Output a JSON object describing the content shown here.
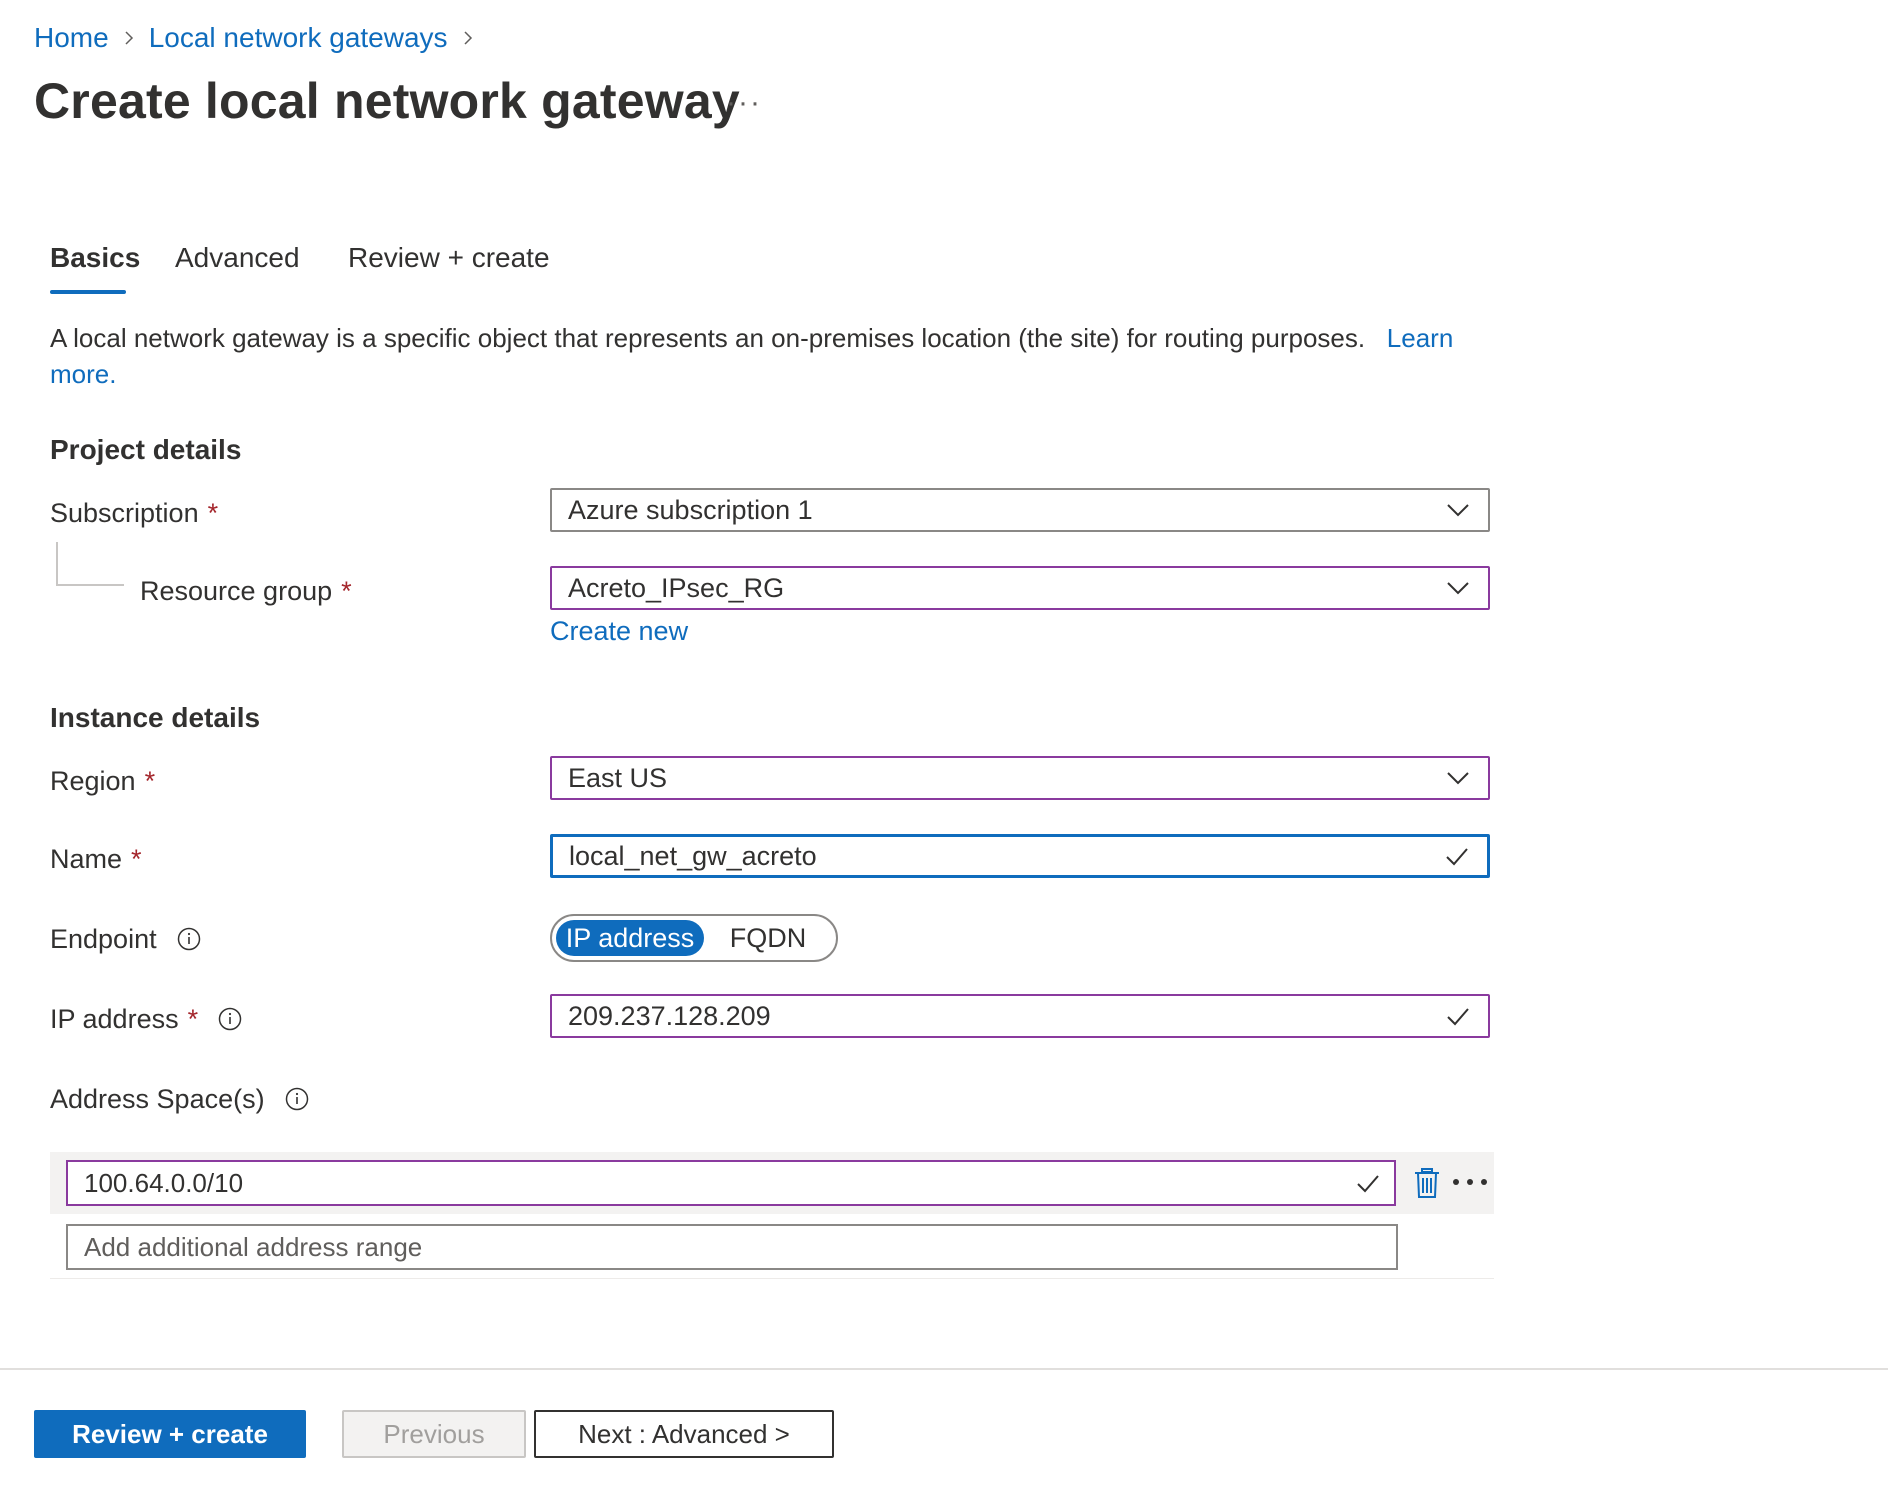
{
  "breadcrumb": {
    "home": "Home",
    "parent": "Local network gateways"
  },
  "page": {
    "title": "Create local network gateway",
    "more": "···"
  },
  "tabs": [
    {
      "label": "Basics",
      "active": true
    },
    {
      "label": "Advanced",
      "active": false
    },
    {
      "label": "Review + create",
      "active": false
    }
  ],
  "description": {
    "text": "A local network gateway is a specific object that represents an on-premises location (the site) for routing purposes.",
    "link": "Learn more."
  },
  "project_details": {
    "title": "Project details",
    "subscription": {
      "label": "Subscription",
      "required": "*",
      "value": "Azure subscription 1"
    },
    "resource_group": {
      "label": "Resource group",
      "required": "*",
      "value": "Acreto_IPsec_RG",
      "create_new": "Create new"
    }
  },
  "instance_details": {
    "title": "Instance details",
    "region": {
      "label": "Region",
      "required": "*",
      "value": "East US"
    },
    "name": {
      "label": "Name",
      "required": "*",
      "value": "local_net_gw_acreto"
    },
    "endpoint": {
      "label": "Endpoint",
      "options": [
        "IP address",
        "FQDN"
      ],
      "selected": "IP address"
    },
    "ip_address": {
      "label": "IP address",
      "required": "*",
      "value": "209.237.128.209"
    },
    "address_spaces": {
      "label": "Address Space(s)",
      "entries": [
        "100.64.0.0/10"
      ],
      "placeholder": "Add additional address range"
    }
  },
  "footer": {
    "review_create": "Review + create",
    "previous": "Previous",
    "next": "Next : Advanced >"
  },
  "colors": {
    "accent": "#0f6cbd",
    "required": "#a4262c",
    "validated_border": "#8a3a9e"
  }
}
